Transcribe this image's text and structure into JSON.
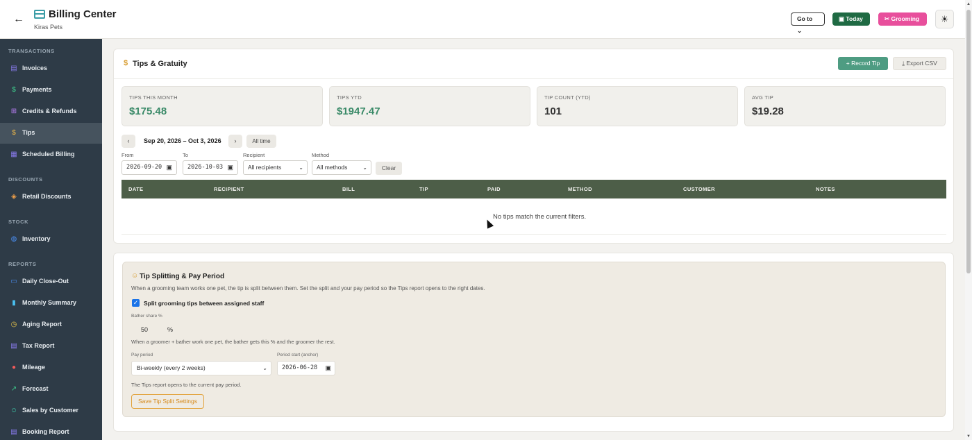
{
  "header": {
    "title": "Billing Center",
    "subtitle": "Kiras Pets",
    "goto_label": "Go to",
    "today_label": "Today",
    "grooming_label": "Grooming"
  },
  "sidebar": {
    "sections": [
      {
        "label": "TRANSACTIONS"
      },
      {
        "label": "DISCOUNTS"
      },
      {
        "label": "STOCK"
      },
      {
        "label": "REPORTS"
      }
    ],
    "items": [
      {
        "label": "Invoices",
        "icon": "document-icon",
        "color": "#8b7cf0"
      },
      {
        "label": "Payments",
        "icon": "dollar-icon",
        "color": "#3ecf8e"
      },
      {
        "label": "Credits & Refunds",
        "icon": "gift-icon",
        "color": "#b57cf0"
      },
      {
        "label": "Tips",
        "icon": "dollar-icon",
        "color": "#e8b44a",
        "active": true
      },
      {
        "label": "Scheduled Billing",
        "icon": "calendar-icon",
        "color": "#8b7cf0"
      },
      {
        "label": "Retail Discounts",
        "icon": "tag-icon",
        "color": "#f0a04a"
      },
      {
        "label": "Inventory",
        "icon": "globe-icon",
        "color": "#4a8ef0"
      },
      {
        "label": "Daily Close-Out",
        "icon": "clipboard-icon",
        "color": "#4a8ef0"
      },
      {
        "label": "Monthly Summary",
        "icon": "bar-chart-icon",
        "color": "#4ac0f0"
      },
      {
        "label": "Aging Report",
        "icon": "clock-icon",
        "color": "#e8c44a"
      },
      {
        "label": "Tax Report",
        "icon": "receipt-icon",
        "color": "#8b7cf0"
      },
      {
        "label": "Mileage",
        "icon": "pin-icon",
        "color": "#f05a5a"
      },
      {
        "label": "Forecast",
        "icon": "trend-icon",
        "color": "#3ecf8e"
      },
      {
        "label": "Sales by Customer",
        "icon": "users-icon",
        "color": "#3ecfae"
      },
      {
        "label": "Booking Report",
        "icon": "document-icon",
        "color": "#8b7cf0"
      }
    ]
  },
  "tips": {
    "title": "Tips & Gratuity",
    "record_label": "+ Record Tip",
    "export_label": "Export CSV",
    "stats": [
      {
        "label": "TIPS THIS MONTH",
        "value": "$175.48"
      },
      {
        "label": "TIPS YTD",
        "value": "$1947.47"
      },
      {
        "label": "TIP COUNT (YTD)",
        "value": "101"
      },
      {
        "label": "AVG TIP",
        "value": "$19.28"
      }
    ],
    "date_range": "Sep 20, 2026 – Oct 3, 2026",
    "all_time_label": "All time",
    "filters": {
      "from_label": "From",
      "from_value": "2026-09-20",
      "to_label": "To",
      "to_value": "2026-10-03",
      "recipient_label": "Recipient",
      "recipient_value": "All recipients",
      "method_label": "Method",
      "method_value": "All methods",
      "clear_label": "Clear"
    },
    "columns": [
      "DATE",
      "RECIPIENT",
      "BILL",
      "TIP",
      "PAID",
      "METHOD",
      "CUSTOMER",
      "NOTES"
    ],
    "empty_message": "No tips match the current filters."
  },
  "tip_split": {
    "title": "Tip Splitting & Pay Period",
    "description": "When a grooming team works one pet, the tip is split between them. Set the split and your pay period so the Tips report opens to the right dates.",
    "checkbox_label": "Split grooming tips between assigned staff",
    "checked": true,
    "bather_share_label": "Bather share %",
    "bather_share_value": "50",
    "percent_sign": "%",
    "bather_note": "When a groomer + bather work one pet, the bather gets this % and the groomer the rest.",
    "pay_period_label": "Pay period",
    "pay_period_value": "Bi-weekly (every 2 weeks)",
    "period_start_label": "Period start (anchor)",
    "period_start_value": "2026-06-28",
    "report_note": "The Tips report opens to the current pay period.",
    "save_label": "Save Tip Split Settings"
  }
}
